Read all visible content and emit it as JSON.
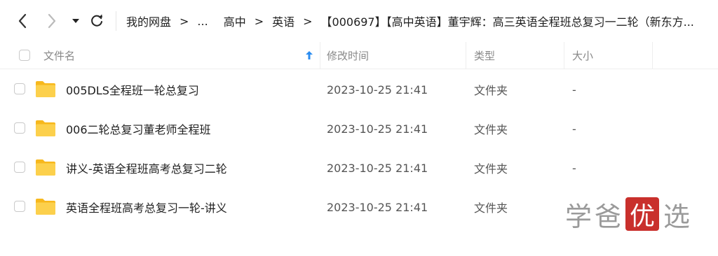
{
  "navbar": {
    "back_icon": "chevron-left-icon",
    "forward_icon": "chevron-right-icon",
    "dropdown_icon": "caret-down-icon",
    "refresh_icon": "refresh-icon"
  },
  "breadcrumb": {
    "items": [
      "我的网盘",
      "...",
      "高中",
      "英语",
      "【000697】【高中英语】董宇辉：高三英语全程班总复习一二轮（新东方..."
    ],
    "separator": ">"
  },
  "columns": {
    "name": "文件名",
    "modified": "修改时间",
    "type": "类型",
    "size": "大小",
    "sort_icon": "sort-up-arrow-icon"
  },
  "files": [
    {
      "name": "005DLS全程班一轮总复习",
      "modified": "2023-10-25 21:41",
      "type": "文件夹",
      "size": "-",
      "icon": "folder-icon"
    },
    {
      "name": "006二轮总复习董老师全程班",
      "modified": "2023-10-25 21:41",
      "type": "文件夹",
      "size": "-",
      "icon": "folder-icon"
    },
    {
      "name": "讲义-英语全程班高考总复习二轮",
      "modified": "2023-10-25 21:41",
      "type": "文件夹",
      "size": "-",
      "icon": "folder-icon"
    },
    {
      "name": "英语全程班高考总复习一轮-讲义",
      "modified": "2023-10-25 21:41",
      "type": "文件夹",
      "size": "",
      "icon": "folder-icon"
    }
  ],
  "watermark": {
    "chars": [
      "学",
      "爸",
      "优",
      "选"
    ]
  },
  "colors": {
    "accent": "#2a8cf0",
    "folder": "#f7c644",
    "watermark_box": "#c9302c"
  }
}
